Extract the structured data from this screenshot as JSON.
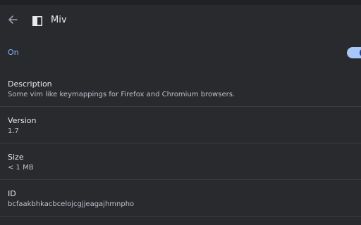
{
  "header": {
    "title": "Miv"
  },
  "toggle": {
    "label": "On",
    "state": "on"
  },
  "details": [
    {
      "label": "Description",
      "value": "Some vim like keymappings for Firefox and Chromium browsers."
    },
    {
      "label": "Version",
      "value": "1.7"
    },
    {
      "label": "Size",
      "value": "< 1 MB"
    },
    {
      "label": "ID",
      "value": "bcfaakbhkacbcelojcgjjeagajhmnpho"
    }
  ],
  "colors": {
    "accent": "#8ab4f8",
    "background": "#292a2d",
    "divider": "#3c3d40"
  }
}
